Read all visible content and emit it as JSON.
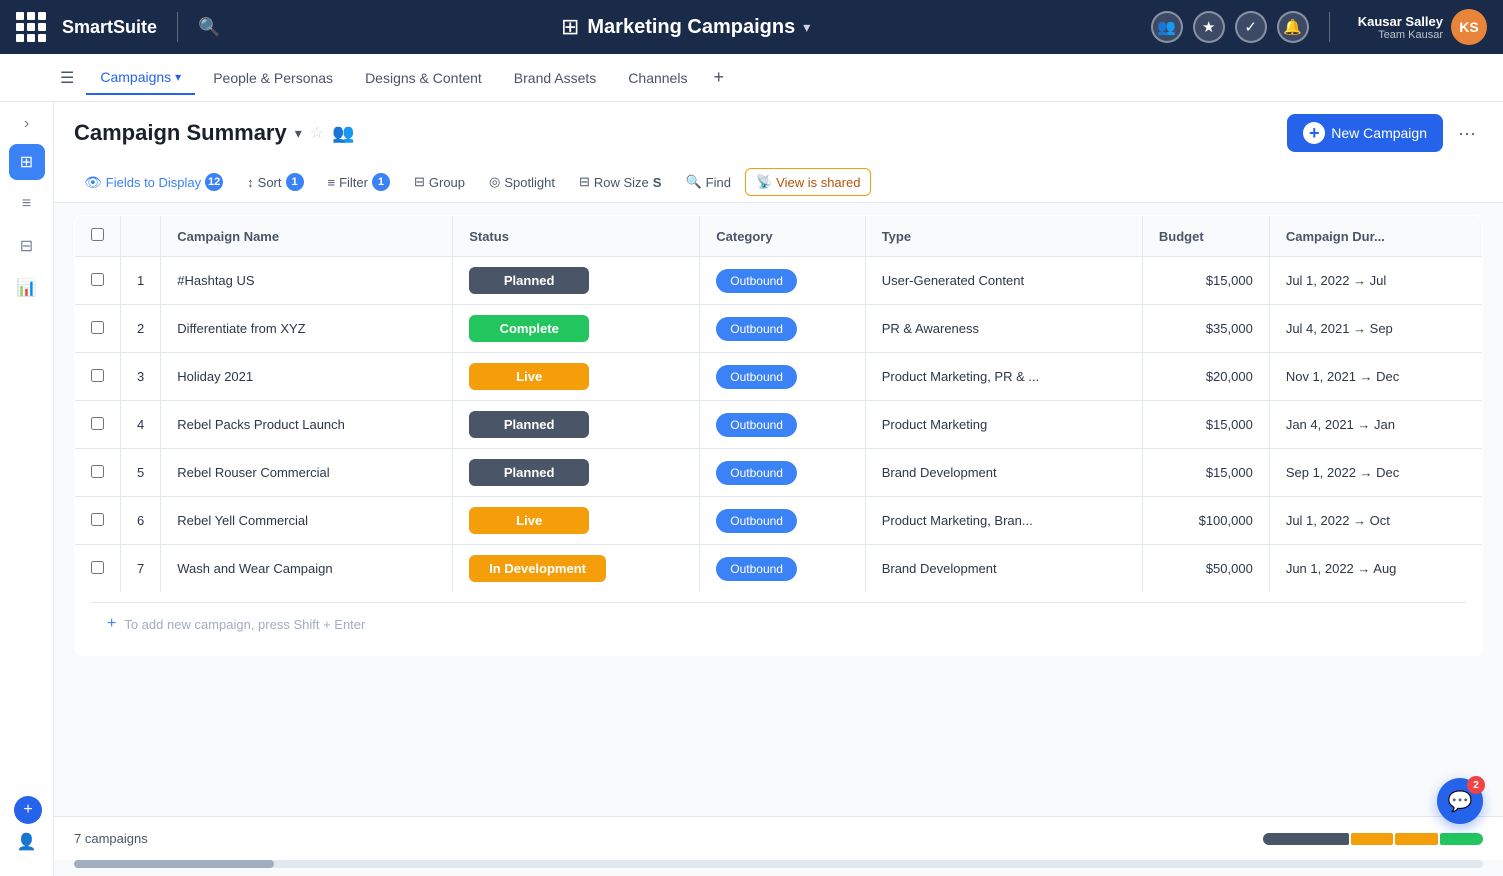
{
  "app": {
    "grid_icon": "grid",
    "brand": "SmartSuite",
    "search_icon": "🔍",
    "app_icon": "⊞",
    "app_title": "Marketing Campaigns",
    "chevron": "▾",
    "user_name": "Kausar Salley",
    "user_team": "Team Kausar",
    "avatar_initials": "KS"
  },
  "nav_icons": [
    {
      "name": "people-icon",
      "icon": "👥"
    },
    {
      "name": "star-nav-icon",
      "icon": "★"
    },
    {
      "name": "check-nav-icon",
      "icon": "✓"
    },
    {
      "name": "bell-icon",
      "icon": "🔔"
    }
  ],
  "tabs": [
    {
      "label": "Campaigns",
      "active": true,
      "has_dropdown": true
    },
    {
      "label": "People & Personas",
      "active": false
    },
    {
      "label": "Designs & Content",
      "active": false
    },
    {
      "label": "Brand Assets",
      "active": false
    },
    {
      "label": "Channels",
      "active": false
    }
  ],
  "page": {
    "title": "Campaign Summary",
    "new_campaign_label": "New Campaign"
  },
  "toolbar": {
    "fields_label": "Fields to Display",
    "fields_count": "12",
    "sort_label": "Sort",
    "sort_count": "1",
    "filter_label": "Filter",
    "filter_count": "1",
    "group_label": "Group",
    "spotlight_label": "Spotlight",
    "row_size_label": "Row Size",
    "row_size_value": "S",
    "find_label": "Find",
    "view_shared_label": "View is shared"
  },
  "table": {
    "columns": [
      "Campaign Name",
      "Status",
      "Category",
      "Type",
      "Budget",
      "Campaign Dur..."
    ],
    "rows": [
      {
        "num": "1",
        "name": "#Hashtag US",
        "status": "Planned",
        "status_class": "status-planned",
        "category": "Outbound",
        "type": "User-Generated Content",
        "budget": "$15,000",
        "duration": "Jul 1, 2022 → Jul"
      },
      {
        "num": "2",
        "name": "Differentiate from XYZ",
        "status": "Complete",
        "status_class": "status-complete",
        "category": "Outbound",
        "type": "PR & Awareness",
        "budget": "$35,000",
        "duration": "Jul 4, 2021 → Sep"
      },
      {
        "num": "3",
        "name": "Holiday 2021",
        "status": "Live",
        "status_class": "status-live",
        "category": "Outbound",
        "type": "Product Marketing, PR & ...",
        "budget": "$20,000",
        "duration": "Nov 1, 2021 → Dec"
      },
      {
        "num": "4",
        "name": "Rebel Packs Product Launch",
        "status": "Planned",
        "status_class": "status-planned",
        "category": "Outbound",
        "type": "Product Marketing",
        "budget": "$15,000",
        "duration": "Jan 4, 2021 → Jan"
      },
      {
        "num": "5",
        "name": "Rebel Rouser Commercial",
        "status": "Planned",
        "status_class": "status-planned",
        "category": "Outbound",
        "type": "Brand Development",
        "budget": "$15,000",
        "duration": "Sep 1, 2022 → Dec"
      },
      {
        "num": "6",
        "name": "Rebel Yell Commercial",
        "status": "Live",
        "status_class": "status-live",
        "category": "Outbound",
        "type": "Product Marketing, Bran...",
        "budget": "$100,000",
        "duration": "Jul 1, 2022 → Oct"
      },
      {
        "num": "7",
        "name": "Wash and Wear Campaign",
        "status": "In Development",
        "status_class": "status-in-development",
        "category": "Outbound",
        "type": "Brand Development",
        "budget": "$50,000",
        "duration": "Jun 1, 2022 → Aug"
      }
    ],
    "add_hint": "To add new campaign, press Shift + Enter"
  },
  "bottom_bar": {
    "count_label": "7 campaigns"
  },
  "status_bar": [
    {
      "color": "#4a5568",
      "flex": 2
    },
    {
      "color": "#f59e0b",
      "flex": 1
    },
    {
      "color": "#f59e0b",
      "flex": 1
    },
    {
      "color": "#22c55e",
      "flex": 1
    }
  ],
  "fab": {
    "badge": "2"
  },
  "sidebar_icons": [
    {
      "name": "grid-view-icon",
      "icon": "⊞",
      "active": true
    },
    {
      "name": "bar-chart-icon",
      "icon": "▤",
      "active": false
    },
    {
      "name": "layout-icon",
      "icon": "⊟",
      "active": false
    },
    {
      "name": "chart-icon",
      "icon": "📊",
      "active": false
    }
  ]
}
